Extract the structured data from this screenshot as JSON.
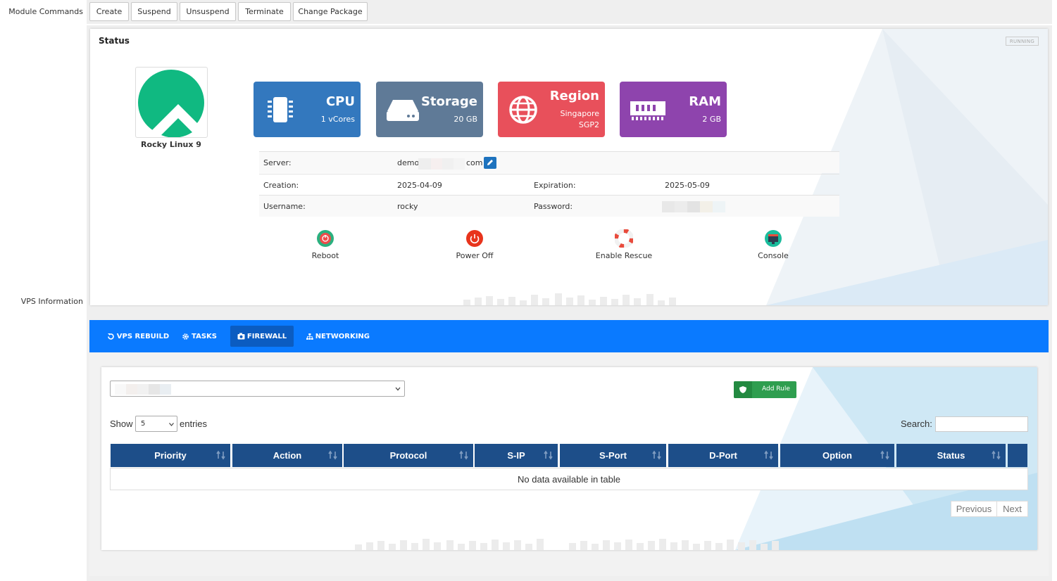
{
  "labels": {
    "module_commands": "Module Commands",
    "vps_information": "VPS Information"
  },
  "commands": [
    "Create",
    "Suspend",
    "Unsuspend",
    "Terminate",
    "Change Package"
  ],
  "status": {
    "title": "Status",
    "badge": "RUNNING",
    "os_name": "Rocky Linux 9",
    "tiles": {
      "cpu": {
        "title": "CPU",
        "value": "1 vCores",
        "color": "#3378be"
      },
      "storage": {
        "title": "Storage",
        "value": "20 GB",
        "color": "#5f7a97"
      },
      "region": {
        "title": "Region",
        "value": "Singapore",
        "value2": "SGP2",
        "color": "#e8505b"
      },
      "ram": {
        "title": "RAM",
        "value": "2 GB",
        "color": "#8e44ad"
      }
    },
    "info": {
      "server_label": "Server:",
      "server_prefix": "demo",
      "server_suffix": "com",
      "creation_label": "Creation:",
      "creation_value": "2025-04-09",
      "expiration_label": "Expiration:",
      "expiration_value": "2025-05-09",
      "username_label": "Username:",
      "username_value": "rocky",
      "password_label": "Password:"
    },
    "actions": [
      "Reboot",
      "Power Off",
      "Enable Rescue",
      "Console"
    ]
  },
  "tabs": [
    {
      "label": "VPS REBUILD",
      "icon": "rotate-icon"
    },
    {
      "label": "TASKS",
      "icon": "gear-icon"
    },
    {
      "label": "FIREWALL",
      "icon": "camera-icon",
      "active": true
    },
    {
      "label": "NETWORKING",
      "icon": "sitemap-icon"
    }
  ],
  "firewall": {
    "add_rule": "Add Rule",
    "show": "Show",
    "entries_count": "5",
    "entries": "entries",
    "search_label": "Search:",
    "columns": [
      "Priority",
      "Action",
      "Protocol",
      "S-IP",
      "S-Port",
      "D-Port",
      "Option",
      "Status"
    ],
    "empty_message": "No data available in table",
    "prev": "Previous",
    "next": "Next"
  }
}
